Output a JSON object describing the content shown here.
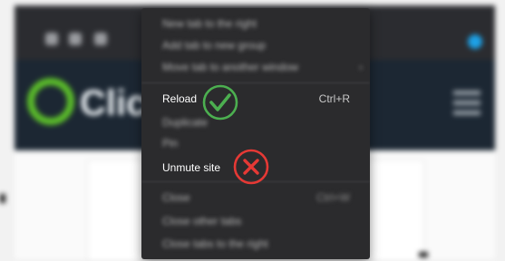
{
  "menu": {
    "items": [
      {
        "label": "New tab to the right",
        "shortcut": ""
      },
      {
        "label": "Add tab to new group",
        "shortcut": ""
      },
      {
        "label": "Move tab to another window",
        "shortcut": ""
      },
      {
        "label": "Reload",
        "shortcut": "Ctrl+R"
      },
      {
        "label": "Duplicate",
        "shortcut": ""
      },
      {
        "label": "Pin",
        "shortcut": ""
      },
      {
        "label": "Unmute site",
        "shortcut": ""
      },
      {
        "label": "Close",
        "shortcut": "Ctrl+W"
      },
      {
        "label": "Close other tabs",
        "shortcut": ""
      },
      {
        "label": "Close tabs to the right",
        "shortcut": ""
      }
    ]
  },
  "background": {
    "logo_text": "Clic"
  },
  "annotations": {
    "check_color": "#4caf50",
    "cross_color": "#e53935"
  }
}
